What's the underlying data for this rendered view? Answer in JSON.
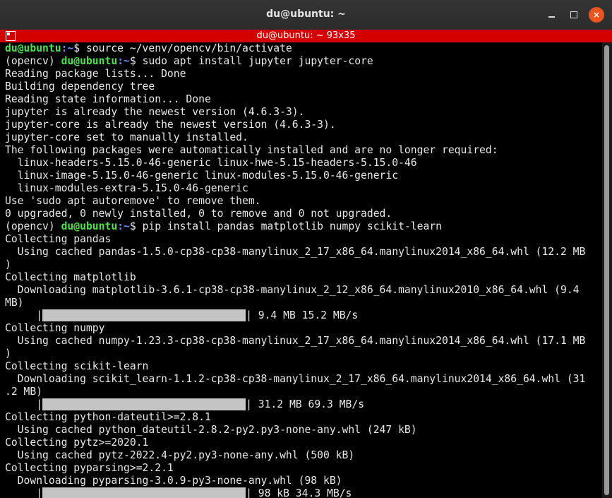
{
  "window": {
    "title": "du@ubuntu: ~",
    "buttons": {
      "minimize": "minimize",
      "maximize": "maximize",
      "close": "×"
    }
  },
  "tab": {
    "title": "du@ubuntu: ~ 93x35"
  },
  "prompt": {
    "user_host": "du@ubuntu",
    "path": ":~",
    "symbol": "$ ",
    "venv": "(opencv) "
  },
  "lines": [
    {
      "type": "prompt",
      "venv": false,
      "cmd": "source ~/venv/opencv/bin/activate"
    },
    {
      "type": "prompt",
      "venv": true,
      "cmd": "sudo apt install jupyter jupyter-core"
    },
    {
      "type": "text",
      "text": "Reading package lists... Done"
    },
    {
      "type": "text",
      "text": "Building dependency tree"
    },
    {
      "type": "text",
      "text": "Reading state information... Done"
    },
    {
      "type": "text",
      "text": "jupyter is already the newest version (4.6.3-3)."
    },
    {
      "type": "text",
      "text": "jupyter-core is already the newest version (4.6.3-3)."
    },
    {
      "type": "text",
      "text": "jupyter-core set to manually installed."
    },
    {
      "type": "text",
      "text": "The following packages were automatically installed and are no longer required:"
    },
    {
      "type": "text",
      "text": "  linux-headers-5.15.0-46-generic linux-hwe-5.15-headers-5.15.0-46"
    },
    {
      "type": "text",
      "text": "  linux-image-5.15.0-46-generic linux-modules-5.15.0-46-generic"
    },
    {
      "type": "text",
      "text": "  linux-modules-extra-5.15.0-46-generic"
    },
    {
      "type": "text",
      "text": "Use 'sudo apt autoremove' to remove them."
    },
    {
      "type": "text",
      "text": "0 upgraded, 0 newly installed, 0 to remove and 0 not upgraded."
    },
    {
      "type": "prompt",
      "venv": true,
      "cmd": "pip install pandas matplotlib numpy scikit-learn"
    },
    {
      "type": "text",
      "text": "Collecting pandas"
    },
    {
      "type": "text",
      "text": "  Using cached pandas-1.5.0-cp38-cp38-manylinux_2_17_x86_64.manylinux2014_x86_64.whl (12.2 MB"
    },
    {
      "type": "text",
      "text": ")"
    },
    {
      "type": "text",
      "text": "Collecting matplotlib"
    },
    {
      "type": "text",
      "text": "  Downloading matplotlib-3.6.1-cp38-cp38-manylinux_2_12_x86_64.manylinux2010_x86_64.whl (9.4"
    },
    {
      "type": "text",
      "text": "MB)"
    },
    {
      "type": "progress",
      "pre": "     |",
      "post": "| 9.4 MB 15.2 MB/s"
    },
    {
      "type": "text",
      "text": "Collecting numpy"
    },
    {
      "type": "text",
      "text": "  Using cached numpy-1.23.3-cp38-cp38-manylinux_2_17_x86_64.manylinux2014_x86_64.whl (17.1 MB"
    },
    {
      "type": "text",
      "text": ")"
    },
    {
      "type": "text",
      "text": "Collecting scikit-learn"
    },
    {
      "type": "text",
      "text": "  Downloading scikit_learn-1.1.2-cp38-cp38-manylinux_2_17_x86_64.manylinux2014_x86_64.whl (31"
    },
    {
      "type": "text",
      "text": ".2 MB)"
    },
    {
      "type": "progress",
      "pre": "     |",
      "post": "| 31.2 MB 69.3 MB/s"
    },
    {
      "type": "text",
      "text": "Collecting python-dateutil>=2.8.1"
    },
    {
      "type": "text",
      "text": "  Using cached python_dateutil-2.8.2-py2.py3-none-any.whl (247 kB)"
    },
    {
      "type": "text",
      "text": "Collecting pytz>=2020.1"
    },
    {
      "type": "text",
      "text": "  Using cached pytz-2022.4-py2.py3-none-any.whl (500 kB)"
    },
    {
      "type": "text",
      "text": "Collecting pyparsing>=2.2.1"
    },
    {
      "type": "text",
      "text": "  Downloading pyparsing-3.0.9-py3-none-any.whl (98 kB)"
    },
    {
      "type": "progress",
      "pre": "     |",
      "post": "| 98 kB 34.3 MB/s"
    }
  ]
}
